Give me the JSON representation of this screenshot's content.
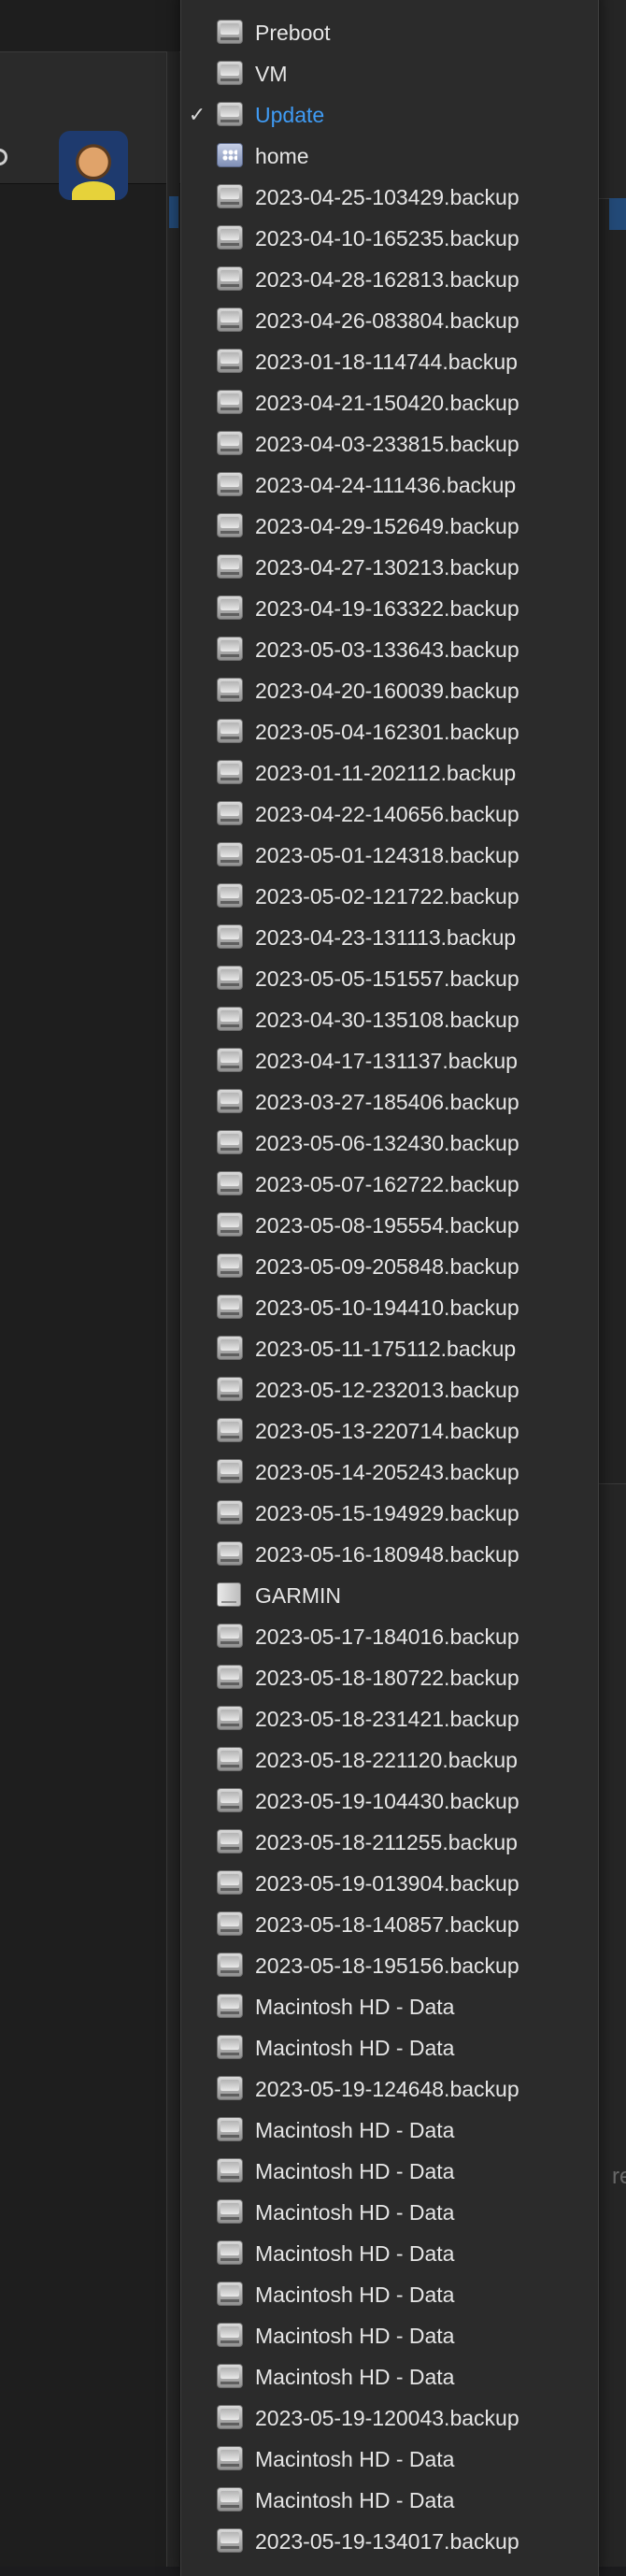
{
  "menu": {
    "items": [
      {
        "label": "Preboot",
        "icon": "disk-icon",
        "checked": false
      },
      {
        "label": "VM",
        "icon": "disk-icon",
        "checked": false
      },
      {
        "label": "Update",
        "icon": "disk-icon",
        "checked": true
      },
      {
        "label": "home",
        "icon": "home-icon",
        "checked": false
      },
      {
        "label": "2023-04-25-103429.backup",
        "icon": "disk-icon",
        "checked": false
      },
      {
        "label": "2023-04-10-165235.backup",
        "icon": "disk-icon",
        "checked": false
      },
      {
        "label": "2023-04-28-162813.backup",
        "icon": "disk-icon",
        "checked": false
      },
      {
        "label": "2023-04-26-083804.backup",
        "icon": "disk-icon",
        "checked": false
      },
      {
        "label": "2023-01-18-114744.backup",
        "icon": "disk-icon",
        "checked": false
      },
      {
        "label": "2023-04-21-150420.backup",
        "icon": "disk-icon",
        "checked": false
      },
      {
        "label": "2023-04-03-233815.backup",
        "icon": "disk-icon",
        "checked": false
      },
      {
        "label": "2023-04-24-111436.backup",
        "icon": "disk-icon",
        "checked": false
      },
      {
        "label": "2023-04-29-152649.backup",
        "icon": "disk-icon",
        "checked": false
      },
      {
        "label": "2023-04-27-130213.backup",
        "icon": "disk-icon",
        "checked": false
      },
      {
        "label": "2023-04-19-163322.backup",
        "icon": "disk-icon",
        "checked": false
      },
      {
        "label": "2023-05-03-133643.backup",
        "icon": "disk-icon",
        "checked": false
      },
      {
        "label": "2023-04-20-160039.backup",
        "icon": "disk-icon",
        "checked": false
      },
      {
        "label": "2023-05-04-162301.backup",
        "icon": "disk-icon",
        "checked": false
      },
      {
        "label": "2023-01-11-202112.backup",
        "icon": "disk-icon",
        "checked": false
      },
      {
        "label": "2023-04-22-140656.backup",
        "icon": "disk-icon",
        "checked": false
      },
      {
        "label": "2023-05-01-124318.backup",
        "icon": "disk-icon",
        "checked": false
      },
      {
        "label": "2023-05-02-121722.backup",
        "icon": "disk-icon",
        "checked": false
      },
      {
        "label": "2023-04-23-131113.backup",
        "icon": "disk-icon",
        "checked": false
      },
      {
        "label": "2023-05-05-151557.backup",
        "icon": "disk-icon",
        "checked": false
      },
      {
        "label": "2023-04-30-135108.backup",
        "icon": "disk-icon",
        "checked": false
      },
      {
        "label": "2023-04-17-131137.backup",
        "icon": "disk-icon",
        "checked": false
      },
      {
        "label": "2023-03-27-185406.backup",
        "icon": "disk-icon",
        "checked": false
      },
      {
        "label": "2023-05-06-132430.backup",
        "icon": "disk-icon",
        "checked": false
      },
      {
        "label": "2023-05-07-162722.backup",
        "icon": "disk-icon",
        "checked": false
      },
      {
        "label": "2023-05-08-195554.backup",
        "icon": "disk-icon",
        "checked": false
      },
      {
        "label": "2023-05-09-205848.backup",
        "icon": "disk-icon",
        "checked": false
      },
      {
        "label": "2023-05-10-194410.backup",
        "icon": "disk-icon",
        "checked": false
      },
      {
        "label": "2023-05-11-175112.backup",
        "icon": "disk-icon",
        "checked": false
      },
      {
        "label": "2023-05-12-232013.backup",
        "icon": "disk-icon",
        "checked": false
      },
      {
        "label": "2023-05-13-220714.backup",
        "icon": "disk-icon",
        "checked": false
      },
      {
        "label": "2023-05-14-205243.backup",
        "icon": "disk-icon",
        "checked": false
      },
      {
        "label": "2023-05-15-194929.backup",
        "icon": "disk-icon",
        "checked": false
      },
      {
        "label": "2023-05-16-180948.backup",
        "icon": "disk-icon",
        "checked": false
      },
      {
        "label": "GARMIN",
        "icon": "external-drive-icon",
        "checked": false
      },
      {
        "label": "2023-05-17-184016.backup",
        "icon": "disk-icon",
        "checked": false
      },
      {
        "label": "2023-05-18-180722.backup",
        "icon": "disk-icon",
        "checked": false
      },
      {
        "label": "2023-05-18-231421.backup",
        "icon": "disk-icon",
        "checked": false
      },
      {
        "label": "2023-05-18-221120.backup",
        "icon": "disk-icon",
        "checked": false
      },
      {
        "label": "2023-05-19-104430.backup",
        "icon": "disk-icon",
        "checked": false
      },
      {
        "label": "2023-05-18-211255.backup",
        "icon": "disk-icon",
        "checked": false
      },
      {
        "label": "2023-05-19-013904.backup",
        "icon": "disk-icon",
        "checked": false
      },
      {
        "label": "2023-05-18-140857.backup",
        "icon": "disk-icon",
        "checked": false
      },
      {
        "label": "2023-05-18-195156.backup",
        "icon": "disk-icon",
        "checked": false
      },
      {
        "label": "Macintosh HD - Data",
        "icon": "disk-icon",
        "checked": false
      },
      {
        "label": "Macintosh HD - Data",
        "icon": "disk-icon",
        "checked": false
      },
      {
        "label": "2023-05-19-124648.backup",
        "icon": "disk-icon",
        "checked": false
      },
      {
        "label": "Macintosh HD - Data",
        "icon": "disk-icon",
        "checked": false
      },
      {
        "label": "Macintosh HD - Data",
        "icon": "disk-icon",
        "checked": false
      },
      {
        "label": "Macintosh HD - Data",
        "icon": "disk-icon",
        "checked": false
      },
      {
        "label": "Macintosh HD - Data",
        "icon": "disk-icon",
        "checked": false
      },
      {
        "label": "Macintosh HD - Data",
        "icon": "disk-icon",
        "checked": false
      },
      {
        "label": "Macintosh HD - Data",
        "icon": "disk-icon",
        "checked": false
      },
      {
        "label": "Macintosh HD - Data",
        "icon": "disk-icon",
        "checked": false
      },
      {
        "label": "2023-05-19-120043.backup",
        "icon": "disk-icon",
        "checked": false
      },
      {
        "label": "Macintosh HD - Data",
        "icon": "disk-icon",
        "checked": false
      },
      {
        "label": "Macintosh HD - Data",
        "icon": "disk-icon",
        "checked": false
      },
      {
        "label": "2023-05-19-134017.backup",
        "icon": "disk-icon",
        "checked": false
      }
    ],
    "check_glyph": "✓",
    "scroll_up_glyph": "⌃"
  },
  "background": {
    "right_partial_text": "re"
  },
  "colors": {
    "menu_bg": "#2b2b2b",
    "selected_text": "#3f9bf4",
    "item_text": "#e6e6e6",
    "app_bg": "#1e1e1e"
  }
}
